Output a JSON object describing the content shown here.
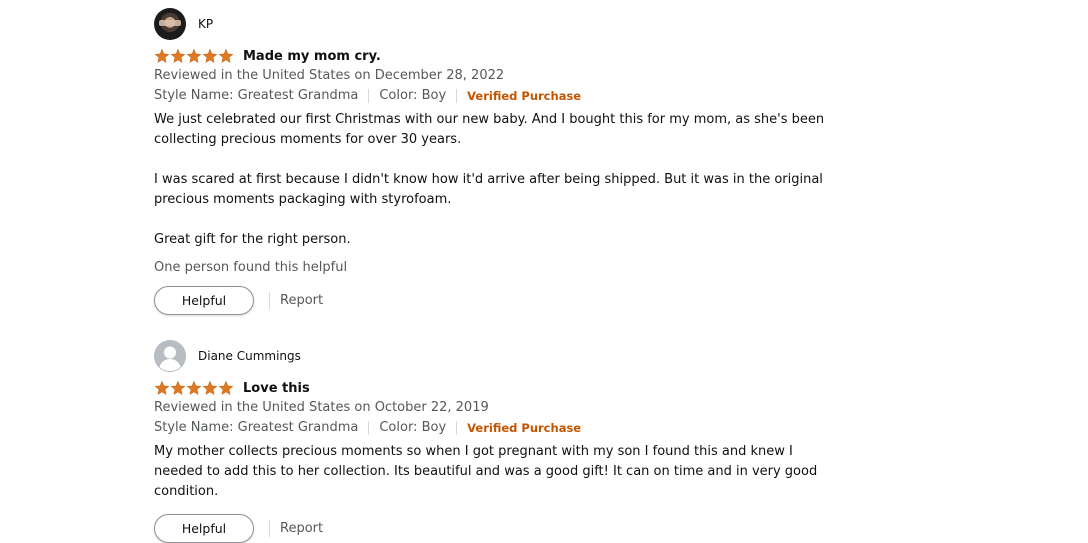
{
  "reviews": [
    {
      "author": "KP",
      "avatar": "user-photo",
      "rating": 5,
      "title": "Made my mom cry.",
      "date_line": "Reviewed in the United States on December 28, 2022",
      "style": "Style Name: Greatest Grandma",
      "color": "Color: Boy",
      "verified": "Verified Purchase",
      "body": [
        "We just celebrated our first Christmas with our new baby. And I bought this for my mom, as she's been collecting precious moments for over 30 years.",
        "I was scared at first because I didn't know how it'd arrive after being shipped. But it was in the original precious moments packaging with styrofoam.",
        "Great gift for the right person."
      ],
      "helpful_count": "One person found this helpful",
      "helpful_label": "Helpful",
      "report_label": "Report"
    },
    {
      "author": "Diane Cummings",
      "avatar": "default-avatar",
      "rating": 5,
      "title": "Love this",
      "date_line": "Reviewed in the United States on October 22, 2019",
      "style": "Style Name: Greatest Grandma",
      "color": "Color: Boy",
      "verified": "Verified Purchase",
      "body": [
        "My mother collects precious moments so when I got pregnant with my son I found this and knew I needed to add this to her collection. Its beautiful and was a good gift! It can on time and in very good condition."
      ],
      "helpful_label": "Helpful",
      "report_label": "Report"
    }
  ],
  "colors": {
    "star": "#de7921",
    "verified": "#c45500",
    "meta": "#565959"
  }
}
